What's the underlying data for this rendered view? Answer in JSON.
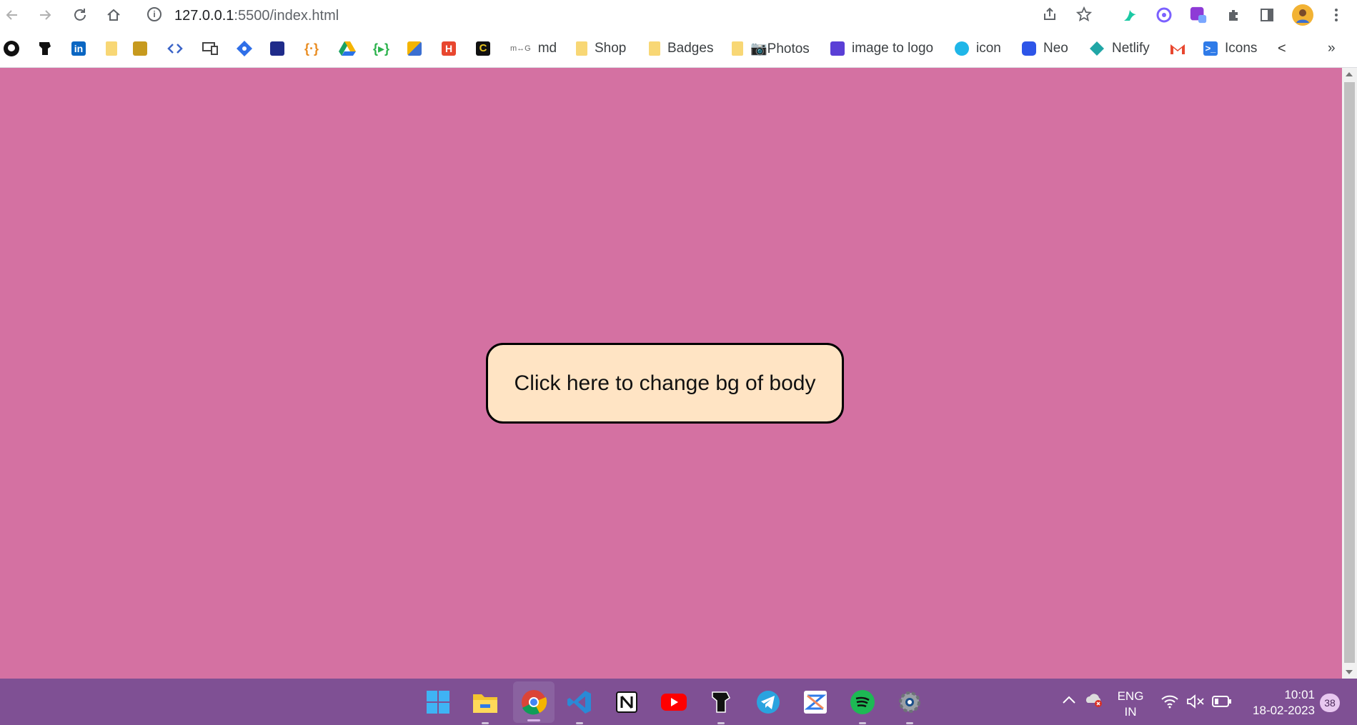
{
  "browser": {
    "url_host": "127.0.0.1",
    "url_path": ":5500/index.html"
  },
  "bookmarks": {
    "items": [
      {
        "label": "md",
        "icon": "mg-icon"
      },
      {
        "label": "Shop",
        "icon": "folder-icon"
      },
      {
        "label": "Badges",
        "icon": "folder-icon"
      },
      {
        "label": "📷Photos",
        "icon": "folder-icon"
      },
      {
        "label": "image to logo",
        "icon": "logo-app-icon"
      },
      {
        "label": "icon",
        "icon": "search-app-icon"
      },
      {
        "label": "Neo",
        "icon": "neo-icon"
      },
      {
        "label": "Netlify",
        "icon": "netlify-icon"
      },
      {
        "label": "Icons",
        "icon": "terminal-icon"
      }
    ],
    "overflow_label": "»"
  },
  "page": {
    "background_color": "#d471a2",
    "button_label": "Click here to change bg of body",
    "button_color": "#ffe4c4"
  },
  "taskbar": {
    "background_color": "#7f5094",
    "apps": [
      "windows-start-icon",
      "file-explorer-icon",
      "chrome-icon",
      "vscode-icon",
      "notion-icon",
      "youtube-icon",
      "bear-icon",
      "telegram-icon",
      "stack-app-icon",
      "spotify-icon",
      "settings-icon"
    ],
    "language_top": "ENG",
    "language_bottom": "IN",
    "time": "10:01",
    "date": "18-02-2023",
    "notification_count": "38"
  }
}
